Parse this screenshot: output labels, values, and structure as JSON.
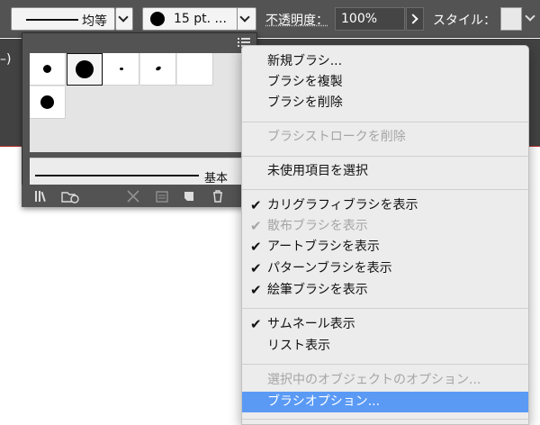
{
  "control_bar": {
    "stroke_profile_label": "均等",
    "brush_definition_label": "15 pt. ...",
    "opacity_label": "不透明度：",
    "opacity_value": "100%",
    "style_label": "スタイル："
  },
  "document": {
    "tab_label": "–)"
  },
  "brush_panel": {
    "basic_stroke_label": "基本",
    "icons": [
      "brush-libraries-icon",
      "libraries-cloud-icon",
      "remove-stroke-icon",
      "options-icon",
      "new-brush-icon",
      "trash-icon"
    ]
  },
  "menu": {
    "items": [
      {
        "label": "新規ブラシ...",
        "enabled": true,
        "checked": false
      },
      {
        "label": "ブラシを複製",
        "enabled": true,
        "checked": false
      },
      {
        "label": "ブラシを削除",
        "enabled": true,
        "checked": false
      },
      {
        "label": "ブラシストロークを削除",
        "enabled": false,
        "checked": false
      },
      {
        "label": "未使用項目を選択",
        "enabled": true,
        "checked": false
      },
      {
        "label": "カリグラフィブラシを表示",
        "enabled": true,
        "checked": true
      },
      {
        "label": "散布ブラシを表示",
        "enabled": false,
        "checked": true
      },
      {
        "label": "アートブラシを表示",
        "enabled": true,
        "checked": true
      },
      {
        "label": "パターンブラシを表示",
        "enabled": true,
        "checked": true
      },
      {
        "label": "絵筆ブラシを表示",
        "enabled": true,
        "checked": true
      },
      {
        "label": "サムネール表示",
        "enabled": true,
        "checked": true
      },
      {
        "label": "リスト表示",
        "enabled": true,
        "checked": false
      },
      {
        "label": "選択中のオブジェクトのオプション...",
        "enabled": false,
        "checked": false
      },
      {
        "label": "ブラシオプション...",
        "enabled": true,
        "checked": false,
        "highlighted": true
      }
    ],
    "checkmark": "✔"
  },
  "colors": {
    "highlight": "#5a9af5",
    "panel_bg": "#535353",
    "menu_bg": "#ececec"
  }
}
